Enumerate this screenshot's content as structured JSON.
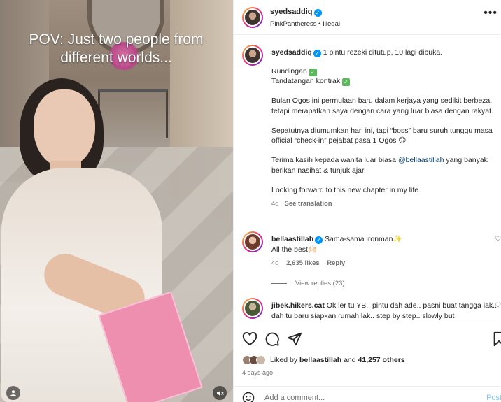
{
  "media": {
    "overlay_text": "POV: Just two people from different worlds...",
    "audio_icon": "mute-icon",
    "tag_icon": "user-tag-icon"
  },
  "header": {
    "username": "syedsaddiq",
    "audio_line": "PinkPantheress • Illegal",
    "more_icon": "more-icon"
  },
  "caption": {
    "username": "syedsaddiq",
    "first_line": "1 pintu rezeki ditutup, 10 lagi dibuka.",
    "line_rundingan": "Rundingan",
    "line_tandatangan": "Tandatangan kontrak",
    "para1": "Bulan Ogos ini permulaan baru dalam kerjaya yang sedikit berbeza, tetapi merapatkan saya dengan cara yang luar biasa dengan rakyat.",
    "para2": "Sepatutnya diumumkan hari ini, tapi “boss” baru suruh tunggu masa official “check-in” pejabat pasa 1 Ogos 🙃",
    "para3_pre": "Terima kasih kepada wanita luar biasa",
    "para3_mention": "@bellaastillah",
    "para3_post": "yang banyak berikan nasihat & tunjuk ajar.",
    "para4": "Looking forward to this new chapter in my life.",
    "time": "4d",
    "see_translation": "See translation"
  },
  "comments": [
    {
      "username": "bellaastillah",
      "text": "Sama-sama ironman✨",
      "text2": "All the best🙌🏻",
      "time": "4d",
      "likes": "2,635 likes",
      "reply": "Reply"
    },
    {
      "username": "jibek.hikers.cat",
      "text": "Ok ler tu YB.. pintu dah ade.. pasni buat tangga lak.. dah tu baru siapkan rumah lak.. step by step.. slowly but"
    }
  ],
  "view_replies": "View replies (23)",
  "actions": {
    "like_icon": "heart-icon",
    "comment_icon": "comment-icon",
    "share_icon": "share-icon",
    "save_icon": "bookmark-icon",
    "liked_by_prefix": "Liked by",
    "liked_by_user": "bellaastillah",
    "liked_by_and": "and",
    "liked_by_count": "41,257 others",
    "date": "4 days ago"
  },
  "add_comment": {
    "placeholder": "Add a comment...",
    "post_label": "Post",
    "emoji_icon": "emoji-icon"
  }
}
